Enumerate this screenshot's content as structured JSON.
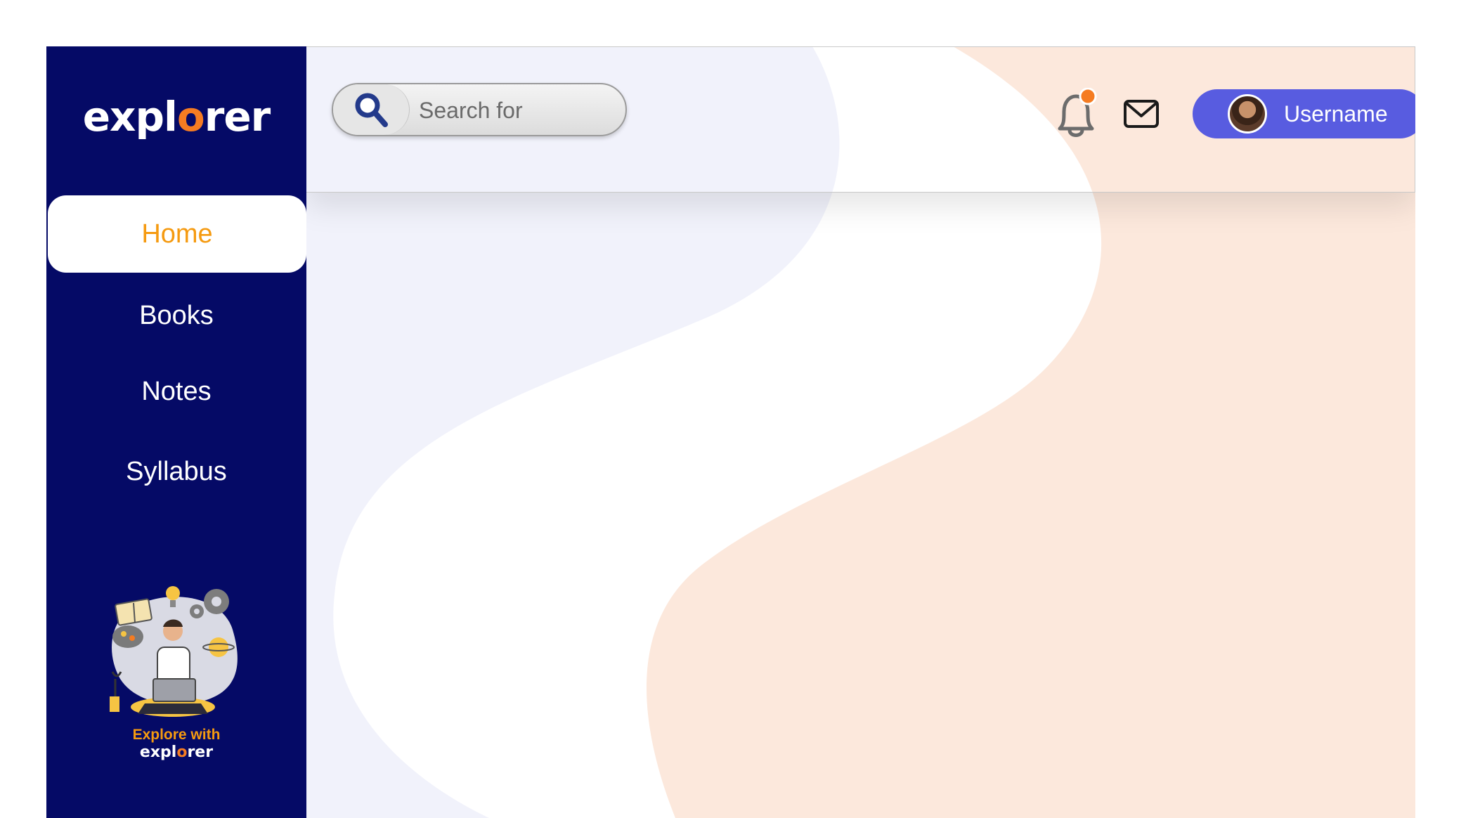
{
  "brand": {
    "logo_pre": "expl",
    "logo_o": "o",
    "logo_post": "rer"
  },
  "sidebar": {
    "items": [
      {
        "label": "Home",
        "active": true
      },
      {
        "label": "Books",
        "active": false
      },
      {
        "label": "Notes",
        "active": false
      },
      {
        "label": "Syllabus",
        "active": false
      }
    ],
    "promo": {
      "line1": "Explore with",
      "line2_pre": "expl",
      "line2_o": "o",
      "line2_post": "rer"
    }
  },
  "header": {
    "search": {
      "placeholder": "Search for",
      "value": ""
    },
    "user": {
      "name": "Username"
    },
    "notification_badge_color": "#f57c22"
  },
  "colors": {
    "sidebar_bg": "#050a66",
    "accent_orange": "#f59a10",
    "user_button": "#585ce0",
    "bg_blue_tint": "#f1f2fb",
    "bg_peach_tint": "#fce8dc"
  },
  "icons": [
    "search-icon",
    "bell-icon",
    "mail-icon",
    "avatar"
  ]
}
